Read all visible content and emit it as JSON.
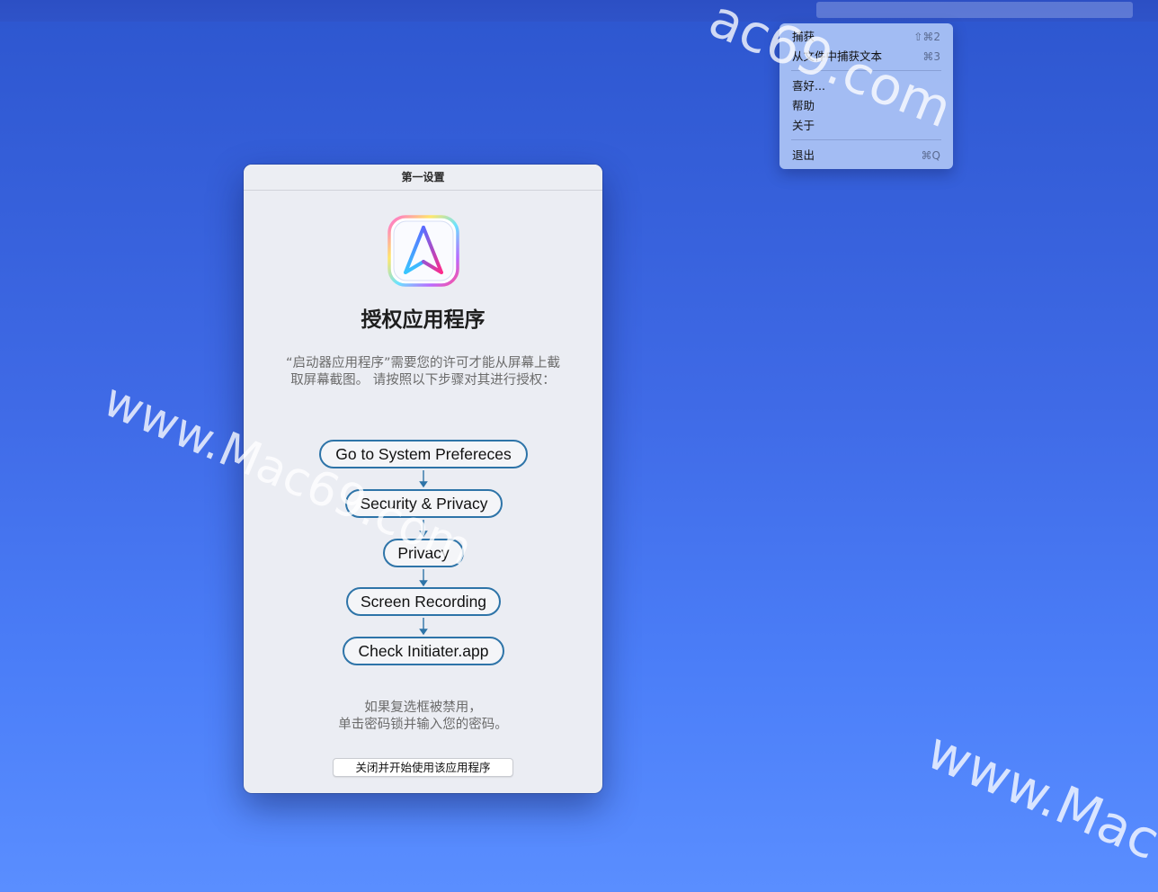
{
  "menu": {
    "items": [
      {
        "label": "捕获",
        "shortcut": "⇧⌘2"
      },
      {
        "label": "从文件中捕获文本",
        "shortcut": "⌘3"
      },
      {
        "label": "喜好...",
        "shortcut": ""
      },
      {
        "label": "帮助",
        "shortcut": ""
      },
      {
        "label": "关于",
        "shortcut": ""
      },
      {
        "label": "退出",
        "shortcut": "⌘Q"
      }
    ]
  },
  "dialog": {
    "title": "第一设置",
    "heading": "授权应用程序",
    "description_line1": "“启动器应用程序”需要您的许可才能从屏幕上截",
    "description_line2": "取屏幕截图。 请按照以下步骤对其进行授权：",
    "steps": [
      "Go to System Prefereces",
      "Security & Privacy",
      "Privacy",
      "Screen Recording",
      "Check Initiater.app"
    ],
    "note_line1": "如果复选框被禁用，",
    "note_line2": "单击密码锁并输入您的密码。",
    "close_button": "关闭并开始使用该应用程序"
  },
  "watermarks": {
    "top": "ac69.com",
    "left": "www.Mac69.com",
    "bottom_right": "www.Mac"
  },
  "icons": {
    "app_icon": "initiater-app-icon"
  },
  "colors": {
    "step_border": "#2e74a8",
    "desktop": "#4170e8"
  }
}
